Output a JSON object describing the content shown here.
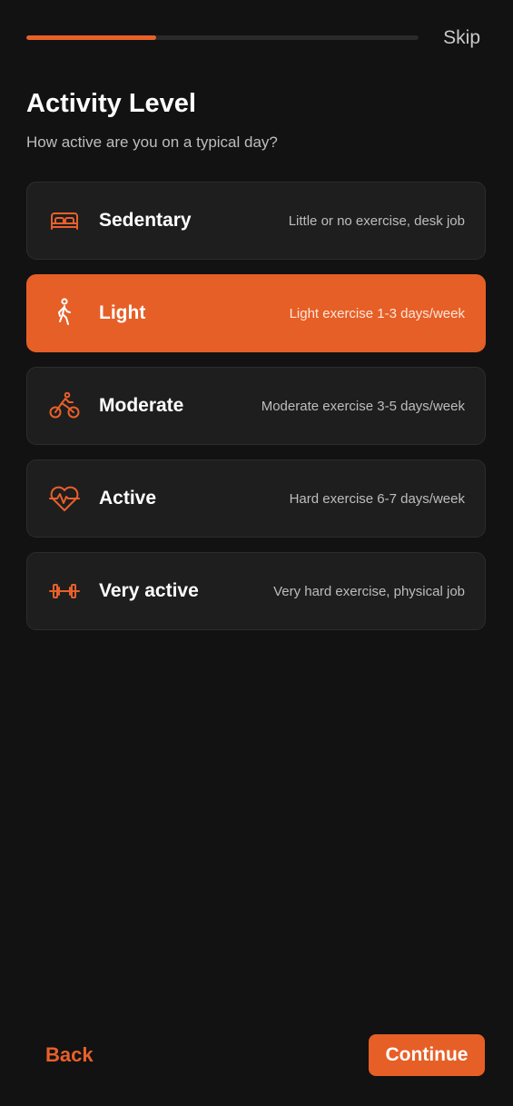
{
  "header": {
    "progress_fraction": 0.33,
    "skip_label": "Skip"
  },
  "title": "Activity Level",
  "subtitle": "How active are you on a typical day?",
  "options": [
    {
      "label": "Sedentary",
      "description": "Little or no exercise, desk job",
      "icon": "bed-icon",
      "selected": false
    },
    {
      "label": "Light",
      "description": "Light exercise 1-3 days/week",
      "icon": "walking-icon",
      "selected": true
    },
    {
      "label": "Moderate",
      "description": "Moderate exercise 3-5 days/week",
      "icon": "bicycle-icon",
      "selected": false
    },
    {
      "label": "Active",
      "description": "Hard exercise 6-7 days/week",
      "icon": "heart-pulse-icon",
      "selected": false
    },
    {
      "label": "Very active",
      "description": "Very hard exercise, physical job",
      "icon": "dumbbell-icon",
      "selected": false
    }
  ],
  "footer": {
    "back_label": "Back",
    "continue_label": "Continue"
  },
  "colors": {
    "accent": "#e8602a",
    "background": "#121212",
    "card": "#1e1e1e"
  }
}
